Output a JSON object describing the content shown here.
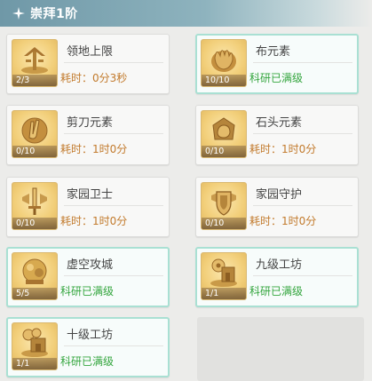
{
  "header": {
    "title": "崇拜1阶",
    "icon": "worship-icon"
  },
  "cards": [
    {
      "name": "领地上限",
      "progress": "2/3",
      "status": "耗时：0分3秒",
      "maxed": false,
      "icon": "territory-icon"
    },
    {
      "name": "布元素",
      "progress": "10/10",
      "status": "科研已满级",
      "maxed": true,
      "icon": "cloth-icon"
    },
    {
      "name": "剪刀元素",
      "progress": "0/10",
      "status": "耗时：1时0分",
      "maxed": false,
      "icon": "scissors-icon"
    },
    {
      "name": "石头元素",
      "progress": "0/10",
      "status": "耗时：1时0分",
      "maxed": false,
      "icon": "rock-icon"
    },
    {
      "name": "家园卫士",
      "progress": "0/10",
      "status": "耗时：1时0分",
      "maxed": false,
      "icon": "sword-icon"
    },
    {
      "name": "家园守护",
      "progress": "0/10",
      "status": "耗时：1时0分",
      "maxed": false,
      "icon": "shield-icon"
    },
    {
      "name": "虚空攻城",
      "progress": "5/5",
      "status": "科研已满级",
      "maxed": true,
      "icon": "siege-icon"
    },
    {
      "name": "九级工坊",
      "progress": "1/1",
      "status": "科研已满级",
      "maxed": true,
      "icon": "workshop-icon"
    },
    {
      "name": "十级工坊",
      "progress": "1/1",
      "status": "科研已满级",
      "maxed": true,
      "icon": "workshop-icon"
    }
  ],
  "colors": {
    "header": "#7ea6b3",
    "pending_status": "#c27a2c",
    "maxed_status": "#35a63f",
    "maxed_border": "#a9e0d3",
    "thumb_bg": "#f2cf7a"
  }
}
